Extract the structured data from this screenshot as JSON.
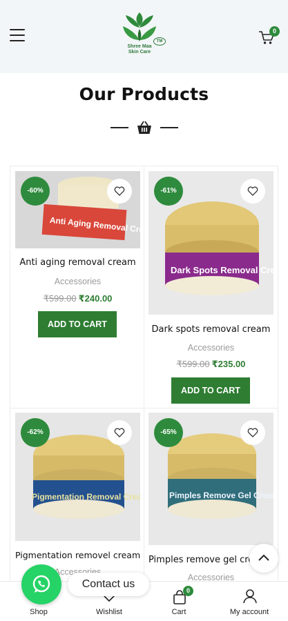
{
  "header": {
    "menu_icon": "hamburger-menu-icon",
    "logo_text_line1": "Shree Maa",
    "logo_text_line2": "Skin Care",
    "logo_tm": "TM",
    "cart_icon": "cart-icon",
    "cart_count": "0"
  },
  "section": {
    "title": "Our Products",
    "divider_icon": "basket-icon"
  },
  "products": [
    {
      "name": "Anti aging removal cream",
      "category": "Accessories",
      "old_price": "₹599.00",
      "new_price": "₹240.00",
      "discount": "-60%",
      "button": "ADD TO CART",
      "jar_label": "Anti Aging Removal Cream",
      "label_color": "#d9473a"
    },
    {
      "name": "Dark spots removal cream",
      "category": "Accessories",
      "old_price": "₹599.00",
      "new_price": "₹235.00",
      "discount": "-61%",
      "button": "ADD TO CART",
      "jar_label": "Dark Spots Removal Cream",
      "label_color": "#8a2a8c"
    },
    {
      "name": "Pigmentation removel cream",
      "category": "Accessories",
      "discount": "-62%",
      "jar_label": "Pigmentation Removal Cream",
      "label_color": "#23508f"
    },
    {
      "name": "Pimples remove gel cream",
      "category": "Accessories",
      "discount": "-65%",
      "jar_label": "Pimples Remove Gel Cream",
      "label_color": "#2f6e7a"
    }
  ],
  "bottom_nav": {
    "shop": "Shop",
    "wishlist": "Wishlist",
    "cart": "Cart",
    "cart_count": "0",
    "account": "My account"
  },
  "floating": {
    "contact": "Contact us"
  },
  "colors": {
    "brand_green": "#2e7d32",
    "badge_green": "#2e8b3d",
    "whatsapp": "#25d366"
  }
}
